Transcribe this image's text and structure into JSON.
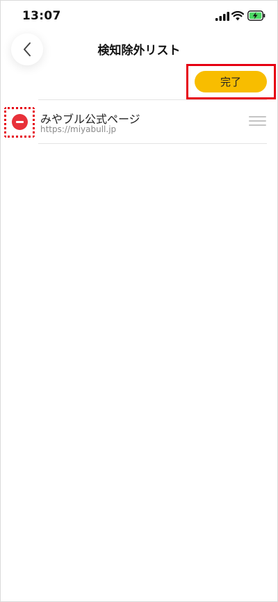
{
  "status_bar": {
    "time": "13:07"
  },
  "header": {
    "title": "検知除外リスト",
    "back_icon": "chevron-left-icon"
  },
  "toolbar": {
    "done_label": "完了"
  },
  "exclusion_list": {
    "items": [
      {
        "title": "みやブル公式ページ",
        "url": "https://miyabull.jp",
        "delete_icon": "minus-circle-icon",
        "reorder_icon": "drag-handle-icon"
      }
    ]
  },
  "colors": {
    "accent": "#f8bd00",
    "delete": "#e8313a",
    "highlight": "#e60012",
    "battery_charging": "#4cd964"
  }
}
